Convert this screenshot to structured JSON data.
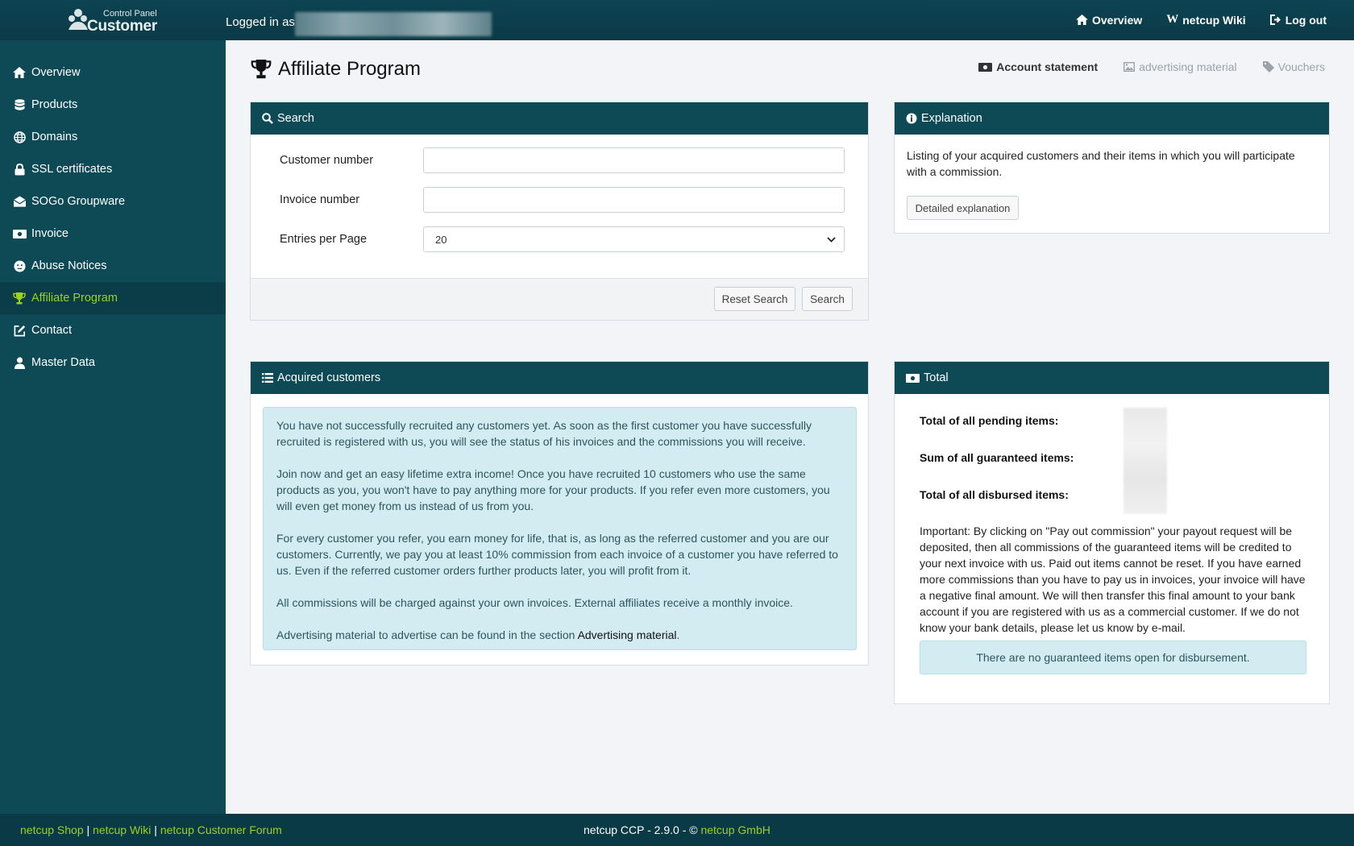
{
  "header": {
    "brand_small": "Control Panel",
    "brand_big": "Customer",
    "logged_in_label": "Logged in as",
    "links": [
      {
        "label": "Overview",
        "icon": "home-icon"
      },
      {
        "label": "netcup Wiki",
        "icon": "wiki-icon"
      },
      {
        "label": "Log out",
        "icon": "logout-icon"
      }
    ]
  },
  "sidebar": {
    "items": [
      {
        "label": "Overview",
        "icon": "home-icon",
        "active": false
      },
      {
        "label": "Products",
        "icon": "database-icon",
        "active": false
      },
      {
        "label": "Domains",
        "icon": "globe-icon",
        "active": false
      },
      {
        "label": "SSL certificates",
        "icon": "lock-icon",
        "active": false
      },
      {
        "label": "SOGo Groupware",
        "icon": "envelope-icon",
        "active": false
      },
      {
        "label": "Invoice",
        "icon": "money-icon",
        "active": false
      },
      {
        "label": "Abuse Notices",
        "icon": "face-icon",
        "active": false
      },
      {
        "label": "Affiliate Program",
        "icon": "trophy-icon",
        "active": true
      },
      {
        "label": "Contact",
        "icon": "edit-icon",
        "active": false
      },
      {
        "label": "Master Data",
        "icon": "user-icon",
        "active": false
      }
    ],
    "accent": "#9ad21e"
  },
  "page": {
    "title": "Affiliate Program",
    "tabs": [
      {
        "label": "Account statement",
        "icon": "money-icon"
      },
      {
        "label": "advertising material",
        "icon": "image-icon"
      },
      {
        "label": "Vouchers",
        "icon": "tag-icon"
      }
    ]
  },
  "search": {
    "title": "Search",
    "customer_label": "Customer number",
    "customer_value": "",
    "invoice_label": "Invoice number",
    "invoice_value": "",
    "entries_label": "Entries per Page",
    "entries_value": "20",
    "reset_label": "Reset Search",
    "search_label": "Search"
  },
  "explanation": {
    "title": "Explanation",
    "text": "Listing of your acquired customers and their items in which you will participate with a commission.",
    "button": "Detailed explanation"
  },
  "acquired": {
    "title": "Acquired customers",
    "p1": "You have not successfully recruited any customers yet. As soon as the first customer you have successfully recruited is registered with us, you will see the status of his invoices and the commissions you will receive.",
    "p2": "Join now and get an easy lifetime extra income! Once you have recruited 10 customers who use the same products as you, you won't have to pay anything more for your products. If you refer even more customers, you will even get money from us instead of us from you.",
    "p3": "For every customer you refer, you earn money for life, that is, as long as the referred customer and you are our customers. Currently, we pay you at least 10% commission from each invoice of a customer you have referred to us. Even if the referred customer orders further products later, you will profit from it.",
    "p4": "All commissions will be charged against your own invoices. External affiliates receive a monthly invoice.",
    "p5_pre": "Advertising material to advertise can be found in the section",
    "p5_link": "Advertising material",
    "p5_post": "."
  },
  "total": {
    "title": "Total",
    "pending_label": "Total of all pending items:",
    "guaranteed_label": "Sum of all guaranteed items:",
    "disbursed_label": "Total of all disbursed items:",
    "important": "Important: By clicking on \"Pay out commission\" your payout request will be deposited, then all commissions of the guaranteed items will be credited to your next invoice with us. Paid out items cannot be reset. If you have earned more commissions than you have to pay us in invoices, your invoice will have a negative final amount. We will then transfer this final amount to your bank account if you are registered with us as a commercial customer. If we do not know your bank details, please let us know by e-mail.",
    "notice": "There are no guaranteed items open for disbursement."
  },
  "footer": {
    "shop": "netcup Shop",
    "sep": "|",
    "wiki": "netcup Wiki",
    "forum": "netcup Customer Forum",
    "version": "netcup CCP - 2.9.0 - ©",
    "company": "netcup GmbH"
  }
}
